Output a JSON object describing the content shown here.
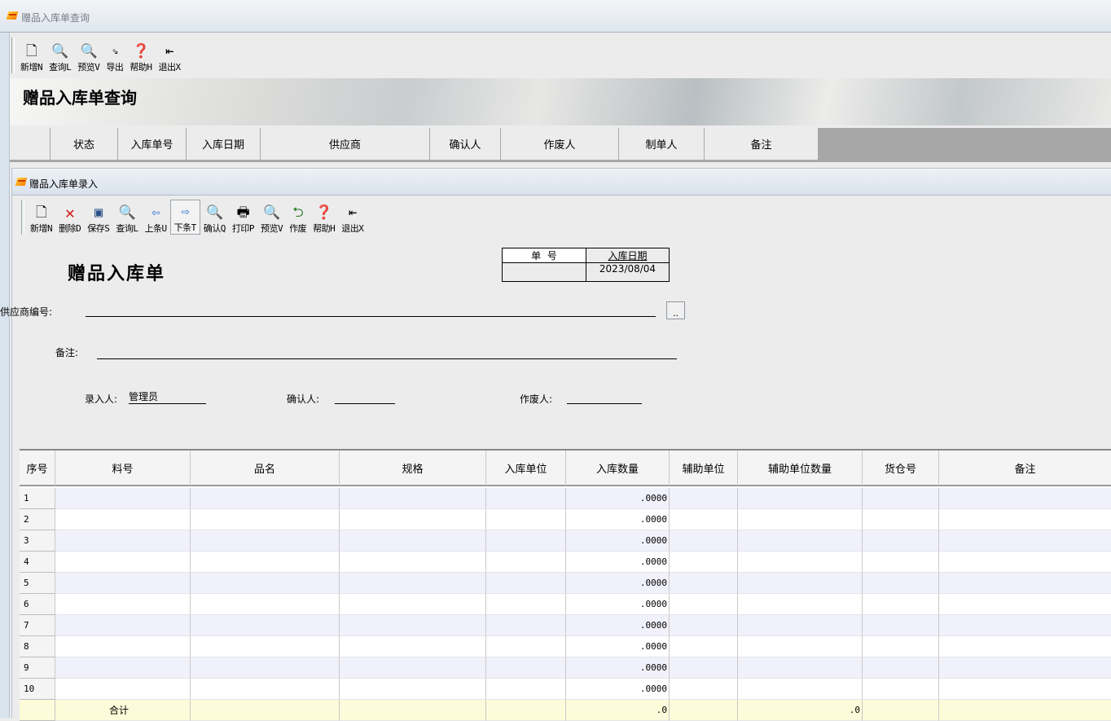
{
  "outer_window": {
    "title": "赠品入库单查询",
    "toolbar": [
      {
        "label": "新增N",
        "icon": "new-doc-icon"
      },
      {
        "label": "查询L",
        "icon": "query-icon"
      },
      {
        "label": "预览V",
        "icon": "preview-icon"
      },
      {
        "label": "导出",
        "icon": "export-icon"
      },
      {
        "label": "帮助H",
        "icon": "help-icon"
      },
      {
        "label": "退出X",
        "icon": "exit-icon"
      }
    ],
    "banner_title": "赠品入库单查询",
    "columns": [
      "状态",
      "入库单号",
      "入库日期",
      "供应商",
      "确认人",
      "作废人",
      "制单人",
      "备注"
    ]
  },
  "inner_window": {
    "title": "赠品入库单录入",
    "toolbar": [
      {
        "label": "新增N",
        "icon": "new-doc-icon"
      },
      {
        "label": "删除D",
        "icon": "delete-icon"
      },
      {
        "label": "保存S",
        "icon": "save-icon"
      },
      {
        "label": "查询L",
        "icon": "query-icon"
      },
      {
        "label": "上条U",
        "icon": "arrow-left-icon"
      },
      {
        "label": "下条T",
        "icon": "arrow-right-icon"
      },
      {
        "label": "确认Q",
        "icon": "confirm-icon"
      },
      {
        "label": "打印P",
        "icon": "print-icon"
      },
      {
        "label": "预览V",
        "icon": "preview-icon"
      },
      {
        "label": "作废",
        "icon": "void-icon"
      },
      {
        "label": "帮助H",
        "icon": "help-icon"
      },
      {
        "label": "退出X",
        "icon": "exit-icon"
      }
    ],
    "doc_title": "赠品入库单",
    "number_header": "单  号",
    "number_value": "",
    "date_header": "入库日期",
    "date_value": "2023/08/04",
    "supplier_label": "供应商编号:",
    "supplier_value": "",
    "browse_label": "..",
    "remark_label": "备注:",
    "remark_value": "",
    "entered_by_label": "录入人:",
    "entered_by_value": "管理员",
    "confirmed_by_label": "确认人:",
    "confirmed_by_value": "",
    "voided_by_label": "作废人:",
    "voided_by_value": ""
  },
  "grid": {
    "columns": [
      "序号",
      "料号",
      "品名",
      "规格",
      "入库单位",
      "入库数量",
      "辅助单位",
      "辅助单位数量",
      "货仓号",
      "备注"
    ],
    "rows": [
      {
        "no": "1",
        "qty": ".0000"
      },
      {
        "no": "2",
        "qty": ".0000"
      },
      {
        "no": "3",
        "qty": ".0000"
      },
      {
        "no": "4",
        "qty": ".0000"
      },
      {
        "no": "5",
        "qty": ".0000"
      },
      {
        "no": "6",
        "qty": ".0000"
      },
      {
        "no": "7",
        "qty": ".0000"
      },
      {
        "no": "8",
        "qty": ".0000"
      },
      {
        "no": "9",
        "qty": ".0000"
      },
      {
        "no": "10",
        "qty": ".0000"
      }
    ],
    "total_label": "合计",
    "total_qty": ".0",
    "total_aux_qty": ".0"
  },
  "colors": {
    "row_alt": "#f1f1fb",
    "total_row": "#fdfbd9",
    "window_bg": "#ececec"
  }
}
